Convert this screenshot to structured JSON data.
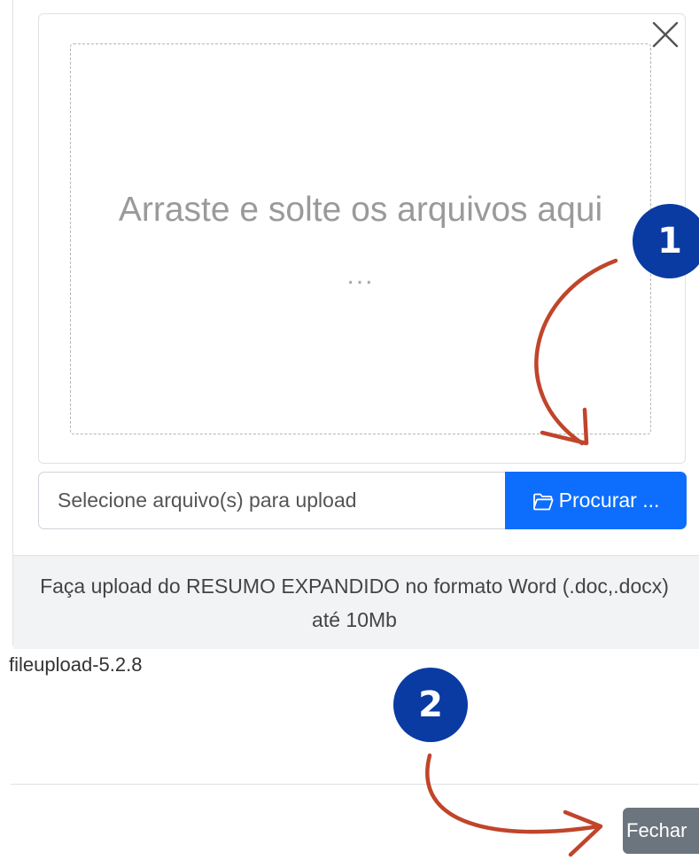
{
  "dropzone": {
    "message": "Arraste e solte os arquivos aqui",
    "ellipsis": "..."
  },
  "close_icon": "close-x-icon",
  "file_input": {
    "caption_placeholder": "Selecione arquivo(s) para upload",
    "browse_label": "Procurar ...",
    "browse_icon": "folder-open-icon",
    "browse_color": "#0d6efd"
  },
  "footer": {
    "message": "Faça upload do RESUMO EXPANDIDO no formato Word (.doc,.docx) até 10Mb"
  },
  "version_label": "fileupload-5.2.8",
  "modal_footer": {
    "close_label": "Fechar",
    "close_color": "#6c757d"
  },
  "annotations": {
    "step1": "1",
    "step2": "2",
    "badge_color": "#0a3ba3",
    "arrow_color": "#c0452b"
  }
}
